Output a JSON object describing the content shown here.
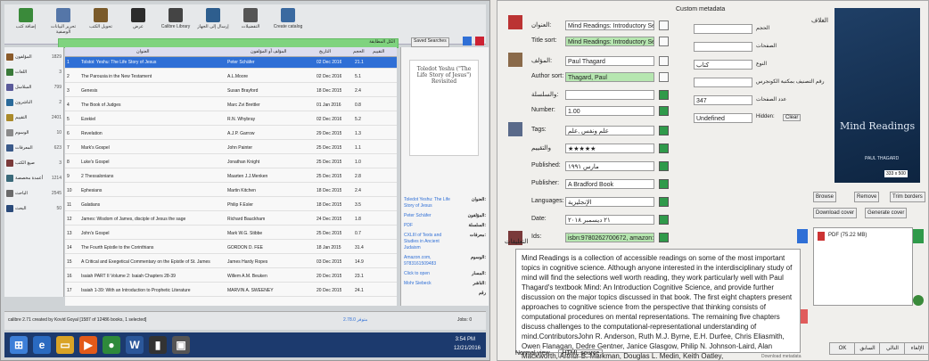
{
  "left": {
    "toolbar": {
      "buttons": [
        "إضافة كتب",
        "تحرير البيانات الوصفية",
        "تحويل الكتب",
        "عرض",
        "Calibre Library",
        "إرسال إلى الجهاز",
        "التفضيلات",
        "Create catalog"
      ]
    },
    "search": {
      "value": "الكل المطابقة",
      "saved": "Saved Searches"
    },
    "sidebar": {
      "items": [
        {
          "label": "المؤلفون",
          "count": "1829"
        },
        {
          "label": "اللغات",
          "count": "3"
        },
        {
          "label": "السلاسل",
          "count": "799"
        },
        {
          "label": "الناشرون",
          "count": "2"
        },
        {
          "label": "التقييم",
          "count": "2401"
        },
        {
          "label": "الوسوم",
          "count": "10"
        },
        {
          "label": "المعرفات",
          "count": "623"
        },
        {
          "label": "صيغ الكتب",
          "count": "3"
        },
        {
          "label": "أعمدة مخصصة",
          "count": "1214"
        },
        {
          "label": "الباحث",
          "count": "2545"
        },
        {
          "label": "البحث",
          "count": "50"
        }
      ]
    },
    "table": {
      "headers": [
        "العنوان",
        "المؤلف أو المؤلفون",
        "التاريخ",
        "الحجم",
        "التقييم"
      ],
      "rows": [
        {
          "n": "1",
          "title": "Tolstoi: Yeshu: The Life Story of Jesus",
          "author": "Peter Schäfer",
          "date": "02 Dec 2016",
          "size": "21.1"
        },
        {
          "n": "2",
          "title": "The Parousia in the New Testament",
          "author": "A.L.Moore",
          "date": "02 Dec 2016",
          "size": "5.1"
        },
        {
          "n": "3",
          "title": "Genesis",
          "author": "Susan Brayford",
          "date": "18 Dec 2015",
          "size": "2.4"
        },
        {
          "n": "4",
          "title": "The Book of Judges",
          "author": "Marc Zvi Brettler",
          "date": "01 Jan 2016",
          "size": "0.8"
        },
        {
          "n": "5",
          "title": "Ezekiel",
          "author": "R.N. Whybray",
          "date": "02 Dec 2016",
          "size": "5.2"
        },
        {
          "n": "6",
          "title": "Revelation",
          "author": "A.J.P. Garrow",
          "date": "29 Dec 2015",
          "size": "1.3"
        },
        {
          "n": "7",
          "title": "Mark's Gospel",
          "author": "John Painter",
          "date": "25 Dec 2015",
          "size": "1.1"
        },
        {
          "n": "8",
          "title": "Luke's Gospel",
          "author": "Jonathan Knight",
          "date": "25 Dec 2015",
          "size": "1.0"
        },
        {
          "n": "9",
          "title": "2 Thessalonians",
          "author": "Maarten J.J.Menken",
          "date": "25 Dec 2015",
          "size": "2.8"
        },
        {
          "n": "10",
          "title": "Ephesians",
          "author": "Martin Kitchen",
          "date": "18 Dec 2015",
          "size": "2.4"
        },
        {
          "n": "11",
          "title": "Galatians",
          "author": "Philip F.Esler",
          "date": "18 Dec 2015",
          "size": "3.5"
        },
        {
          "n": "12",
          "title": "James: Wisdom of James, disciple of Jesus the sage",
          "author": "Richard Bauckham",
          "date": "24 Dec 2015",
          "size": "1.8"
        },
        {
          "n": "13",
          "title": "John's Gospel",
          "author": "Mark W.G. Stibbe",
          "date": "25 Dec 2015",
          "size": "0.7"
        },
        {
          "n": "14",
          "title": "The Fourth Epistle to the Corinthians",
          "author": "GORDON D. FEE",
          "date": "18 Jan 2015",
          "size": "31.4"
        },
        {
          "n": "15",
          "title": "A Critical and Exegetical Commentary on the Epistle of St. James",
          "author": "James Hardy Ropes",
          "date": "03 Dec 2015",
          "size": "14.9"
        },
        {
          "n": "16",
          "title": "Isaiah PART II Volume 2: Isaiah Chapters 28-39",
          "author": "Willem A.M. Beuken",
          "date": "20 Dec 2015",
          "size": "23.1"
        },
        {
          "n": "17",
          "title": "Isaiah 1-39: With an Introduction to Prophetic Literature",
          "author": "MARVIN A. SWEENEY",
          "date": "20 Dec 2015",
          "size": "24.1"
        }
      ]
    },
    "detail": {
      "cover_text": "Toledot Yeshu (\"The Life Story of Jesus\") Revisited",
      "labels": [
        "العنوان:",
        "المؤلفون:",
        "السلسلة:",
        "معرفات:",
        "الوسوم:",
        "المسار:",
        "الناشر:",
        "رقم"
      ],
      "values": [
        "Toledot Yeshu: The Life Story of Jesus",
        "Peter Schäfer",
        "PDF",
        "CXLIII of Texts and Studies in Ancient Judaism",
        "Amazon.com, 9783161509483",
        "Click to open",
        "Mohr Siebeck"
      ]
    },
    "status": {
      "text": "calibre 2.71 created by Kovid Goyal   [1587 of 12486 books, 1 selected]",
      "jobs": "Jobs: 0",
      "update": "2.78.0 متوفر"
    },
    "taskbar": {
      "time": "3:54 PM",
      "date": "12/21/2016"
    }
  },
  "right": {
    "fields": {
      "title": {
        "label": "العنوان:",
        "value": "Mind Readings: Introductory Selections"
      },
      "title_sort": {
        "label": "Title sort:",
        "value": "Mind Readings: Introductory Selections"
      },
      "authors": {
        "label": "المؤلف:",
        "value": "Paul Thagard"
      },
      "author_sort": {
        "label": "Author sort:",
        "value": "Thagard, Paul"
      },
      "series": {
        "label": "والسلسلة:",
        "value": ""
      },
      "number": {
        "label": "Number:",
        "value": "1.00"
      },
      "tags": {
        "label": "Tags:",
        "value": "علم ونفس ,علم"
      },
      "rating": {
        "label": "والتقييم",
        "value": "★★★★★"
      },
      "published": {
        "label": "Published:",
        "value": "مارس ١٩٩١"
      },
      "publisher": {
        "label": "Publisher:",
        "value": "A Bradford Book"
      },
      "languages": {
        "label": "Languages:",
        "value": "الإنجليزية"
      },
      "date": {
        "label": "Date:",
        "value": "٢١ ديسمبر ٢٠١٨"
      },
      "ids": {
        "label": "Ids:",
        "value": "isbn:9780262700672, amazon:026270066"
      }
    },
    "custom": {
      "header": "Custom metadata",
      "rows": [
        {
          "label": "الحجم",
          "value": ""
        },
        {
          "label": "الصفحات",
          "value": ""
        },
        {
          "label": "النوع",
          "value": "كتاب"
        },
        {
          "label": "رقم التصنيف بمكتبة الكونجرس",
          "value": ""
        },
        {
          "label": "عدد الصفحات",
          "value": "347"
        },
        {
          "label": "Hidden:",
          "value": "Undefined"
        }
      ],
      "clear": "Clear"
    },
    "cover": {
      "title": "Mind Readings",
      "author": "PAUL THAGARD",
      "size": "333 x 500",
      "tab": "الغلاف"
    },
    "cover_buttons": [
      "Browse",
      "Remove",
      "Trim borders",
      "Download cover",
      "Generate cover"
    ],
    "formats": {
      "item": "PDF (75.22 MB)"
    },
    "comments": {
      "header": "التعليقات",
      "text": "Mind Readings is a collection of accessible readings on some of the most important topics in cognitive science. Although anyone interested in the interdisciplinary study of mind will find the selections well worth reading, they work particularly well with Paul Thagard's textbook Mind: An Introduction Cognitive Science, and provide further discussion on the major topics discussed in that book. The first eight chapters present approaches to cognitive science from the perspective that thinking consists of computational procedures on mental representations. The remaining five chapters discuss challenges to the computational-representational understanding of mind.ContributorsJohn R. Anderson, Ruth M.J. Byrne, E.H. Durfee, Chris Eliasmith, Owen Flanagan, Dedre Gentner, Janice Glasgow, Philip N. Johnson-Laird, Alan Mackworth, Arthur B. Markman, Douglas L. Medin, Keith Oatley,",
      "tabs": [
        "Normal view",
        "HTML source"
      ]
    },
    "footer": {
      "buttons": [
        "OK",
        "السابق",
        "التالي",
        "الإلغاء"
      ],
      "download": "Download metadata"
    }
  }
}
